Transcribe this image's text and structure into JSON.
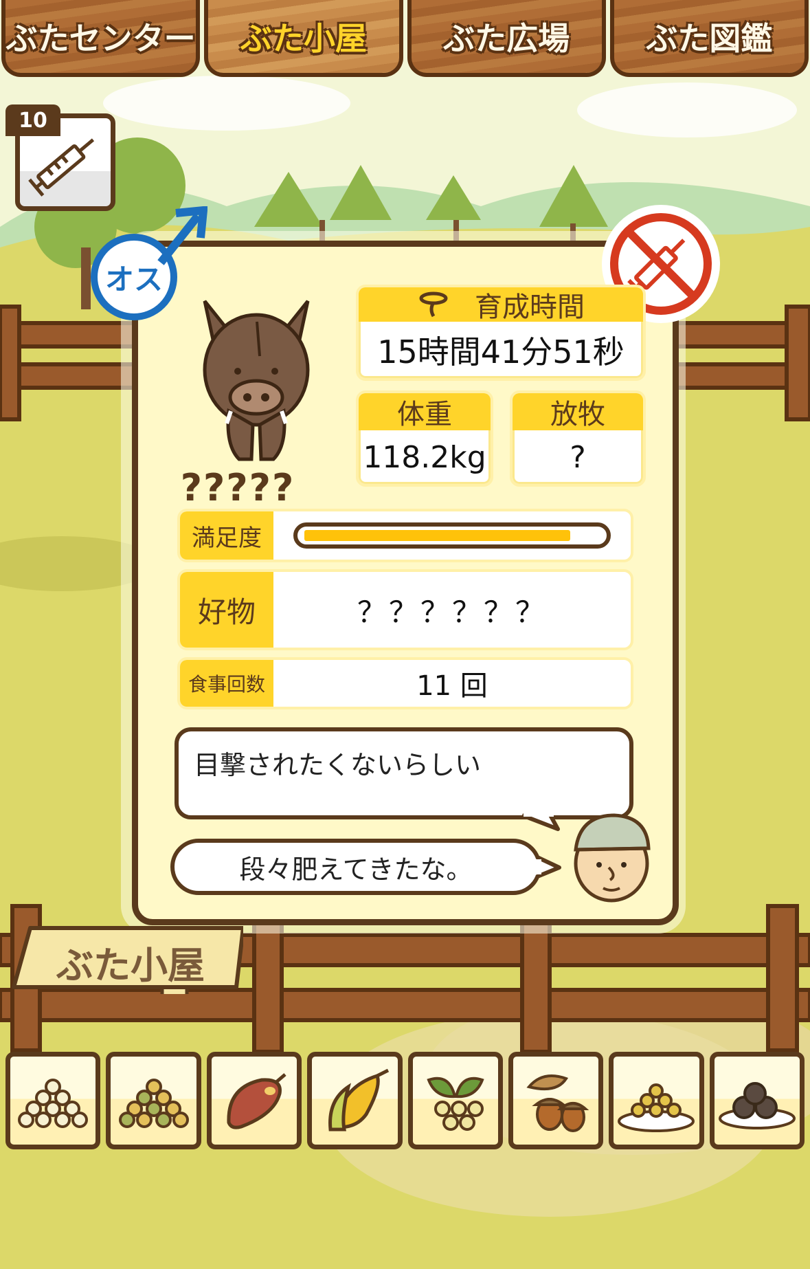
{
  "tabs": [
    {
      "label": "ぶたセンター",
      "active": false
    },
    {
      "label": "ぶた小屋",
      "active": true
    },
    {
      "label": "ぶた広場",
      "active": false
    },
    {
      "label": "ぶた図鑑",
      "active": false
    }
  ],
  "items": {
    "syringe_count": "10"
  },
  "pig": {
    "gender_label": "オス",
    "name": "?????",
    "raising_time_label": "育成時間",
    "raising_time": "15時間41分51秒",
    "weight_label": "体重",
    "weight": "118.2kg",
    "grazing_label": "放牧",
    "grazing": "?",
    "satisfaction_label": "満足度",
    "satisfaction_fraction": 0.9,
    "favorite_label": "好物",
    "favorite": "？？？？？？",
    "meals_label": "食事回数",
    "meals": "11 回",
    "description": "目撃されたくないらしい",
    "farmer_comment": "段々肥えてきたな。"
  },
  "sign_label": "ぶた小屋",
  "food_items": [
    {
      "name": "beans-icon"
    },
    {
      "name": "mixed-beans-icon"
    },
    {
      "name": "sweet-potato-icon"
    },
    {
      "name": "corn-icon"
    },
    {
      "name": "soybean-plant-icon"
    },
    {
      "name": "acorn-icon"
    },
    {
      "name": "beans-plate-icon"
    },
    {
      "name": "dark-dumplings-icon"
    }
  ],
  "colors": {
    "accent_yellow": "#ffd42a",
    "wood_dark": "#5a3a1c",
    "male_blue": "#1c6fbf",
    "no_syringe_red": "#d63a1f",
    "grass": "#dcd869"
  }
}
